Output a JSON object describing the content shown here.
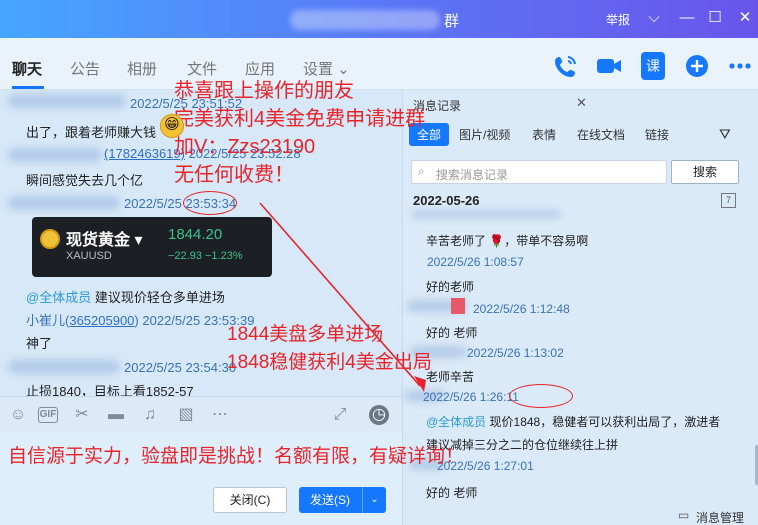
{
  "window": {
    "title": "群",
    "report": "举报"
  },
  "tabs": [
    {
      "label": "聊天"
    },
    {
      "label": "公告"
    },
    {
      "label": "相册"
    },
    {
      "label": "文件"
    },
    {
      "label": "应用"
    },
    {
      "label": "设置 ⌄"
    }
  ],
  "toolbar_icons": [
    "phone-icon",
    "video-icon",
    "class-icon",
    "add-app-icon",
    "more-icon"
  ],
  "toolbar_class_label": "课",
  "chat": {
    "items": [
      {
        "meta": "2022/5/25 23:51:52"
      },
      {
        "text": "出了，跟着老师赚大钱"
      },
      {
        "meta_link": "(1782463619)",
        "meta": " 2022/5/25 23:52:28"
      },
      {
        "text": "瞬间感觉失去几个亿"
      },
      {
        "meta": "2022/5/25 23:53:34"
      },
      {
        "mention": "@全体成员",
        "text": " 建议现价轻仓多单进场"
      },
      {
        "sender": "小崔儿(",
        "sender_link": "365205900",
        "sender_end": ")",
        "meta": " 2022/5/25 23:53:39"
      },
      {
        "text": "神了"
      },
      {
        "meta": "2022/5/25 23:54:30"
      },
      {
        "text": "止损1840，目标上看1852-57"
      }
    ],
    "quote_card": {
      "name": "现货黄金 ▾",
      "code": "XAUUSD",
      "price": "1844.20",
      "change": "−22.93  −1.23%"
    }
  },
  "input_bar_icons": [
    "emoji-icon",
    "gif-icon",
    "scissors-icon",
    "folder-icon",
    "music-icon",
    "image-icon",
    "more-icon",
    "expand-icon",
    "history-icon"
  ],
  "gif_label": "GIF",
  "buttons": {
    "close": "关闭(C)",
    "send": "发送(S)",
    "send_dropdown": "⌄"
  },
  "history": {
    "title": "消息记录",
    "close": "✕",
    "filters": [
      "全部",
      "图片/视频",
      "表情",
      "在线文档",
      "链接"
    ],
    "search_placeholder": "搜索消息记录",
    "search_button": "搜索",
    "date": "2022-05-26",
    "calendar_day": "7",
    "items": [
      {
        "text": "辛苦老师了 🌹，带单不容易啊"
      },
      {
        "meta": "2022/5/26 1:08:57"
      },
      {
        "text": "好的老师"
      },
      {
        "meta": "2022/5/26 1:12:48"
      },
      {
        "text": "好的  老师"
      },
      {
        "meta": "2022/5/26 1:13:02"
      },
      {
        "text": "老师辛苦"
      },
      {
        "meta": "2022/5/26 1:26:11"
      },
      {
        "mention": "@全体成员",
        "text": " 现价1848，稳健者可以获利出局了，激进者"
      },
      {
        "text": "建议减掉三分之二的仓位继续往上拼"
      },
      {
        "meta": "2022/5/26 1:27:01"
      },
      {
        "text": "好的  老师"
      }
    ],
    "manage": "消息管理"
  },
  "overlays": {
    "promo_lines": [
      "恭喜跟上操作的朋友",
      "完美获利4美金免费申请进群",
      "加V：Zzs23190",
      "无任何收费！"
    ],
    "middle_lines": [
      "1844美盘多单进场",
      "1848稳健获利4美金出局"
    ],
    "bottom": "自信源于实力，验盘即是挑战！名额有限，有疑详询！"
  },
  "colors": {
    "accent": "#1677ff",
    "overlay_red": "#e8242a"
  }
}
